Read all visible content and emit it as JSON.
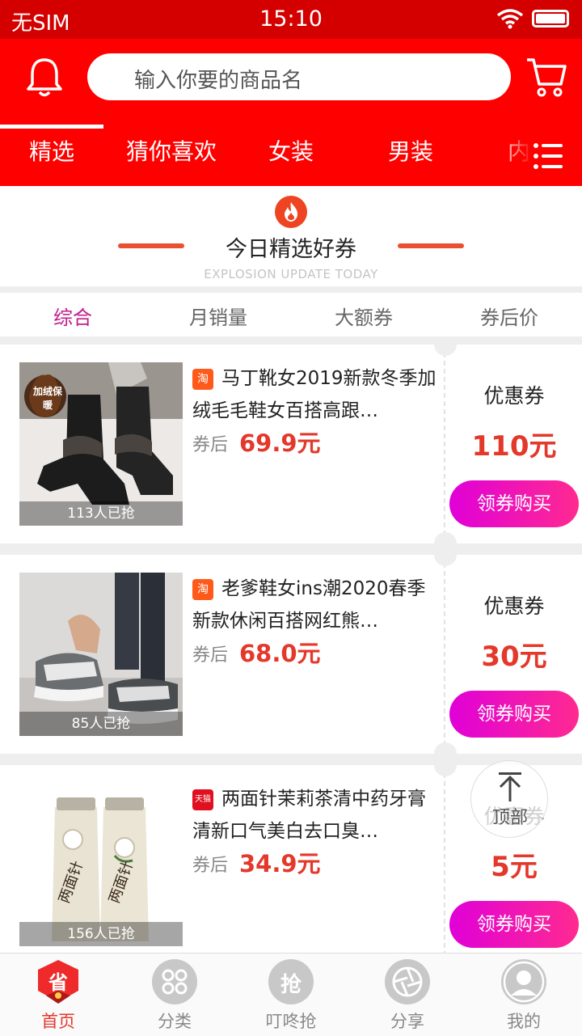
{
  "status_bar": {
    "carrier": "无SIM",
    "time": "15:10"
  },
  "header": {
    "search": {
      "placeholder": "输入你要的商品名"
    },
    "tabs": [
      {
        "label": "精选",
        "active": true
      },
      {
        "label": "猜你喜欢"
      },
      {
        "label": "女装"
      },
      {
        "label": "男装"
      },
      {
        "label": "内衣"
      }
    ]
  },
  "banner": {
    "title": "今日精选好券",
    "subtitle": "EXPLOSION UPDATE TODAY"
  },
  "sort_tabs": [
    {
      "label": "综合",
      "active": true
    },
    {
      "label": "月销量"
    },
    {
      "label": "大额券"
    },
    {
      "label": "券后价"
    }
  ],
  "products": [
    {
      "badge": "淘",
      "title": "马丁靴女2019新款冬季加绒毛毛鞋女百搭高跟…",
      "after_label": "券后",
      "price": "69.9元",
      "sold": "113人已抢",
      "image_tag": "加绒保暖",
      "coupon_label": "优惠券",
      "coupon_amount": "110元",
      "button": "领券购买"
    },
    {
      "badge": "淘",
      "title": "老爹鞋女ins潮2020春季新款休闲百搭网红熊…",
      "after_label": "券后",
      "price": "68.0元",
      "sold": "85人已抢",
      "coupon_label": "优惠券",
      "coupon_amount": "30元",
      "button": "领券购买"
    },
    {
      "badge": "天猫",
      "title": "两面针茉莉茶清中药牙膏清新口气美白去口臭…",
      "after_label": "券后",
      "price": "34.9元",
      "sold": "156人已抢",
      "coupon_label": "优惠券",
      "coupon_amount": "5元",
      "button": "领券购买"
    }
  ],
  "back_to_top": {
    "label": "顶部"
  },
  "tab_bar": [
    {
      "label": "首页",
      "icon_text": "省",
      "active": true
    },
    {
      "label": "分类"
    },
    {
      "label": "叮咚抢",
      "icon_text": "抢"
    },
    {
      "label": "分享"
    },
    {
      "label": "我的"
    }
  ],
  "colors": {
    "header": "#ff0000",
    "status": "#d40000",
    "price": "#e4382b",
    "accent": "#c0208a"
  }
}
